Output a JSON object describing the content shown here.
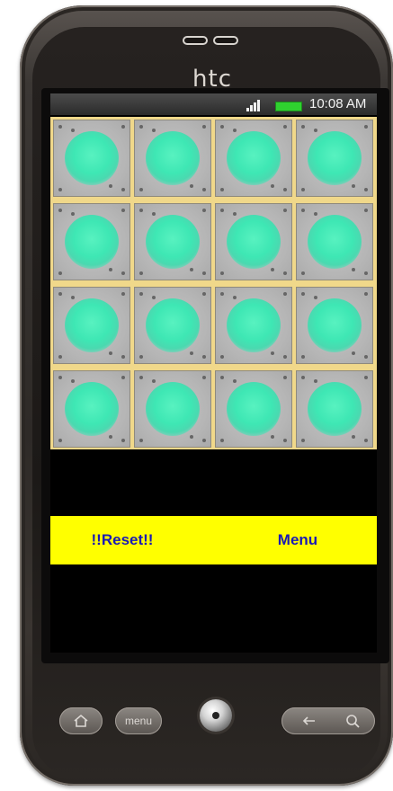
{
  "device": {
    "brand": "htc"
  },
  "status_bar": {
    "time": "10:08 AM",
    "signal_icon": "signal-bars-icon",
    "battery_icon": "battery-icon",
    "battery_color": "#2fd12f"
  },
  "board": {
    "rows": 4,
    "cols": 4,
    "cell_icon": "glowing-light-tile",
    "glow_color": "#3ee7b4",
    "grid_line_color": "#f0d88a"
  },
  "actions": {
    "reset_label": "!!Reset!!",
    "menu_label": "Menu",
    "bar_color": "#ffff00",
    "text_color": "#1a1ab4"
  },
  "hardware_keys": {
    "home_icon": "home-icon",
    "menu_label": "menu",
    "back_icon": "back-arrow-icon",
    "search_icon": "search-icon",
    "trackball": "trackball"
  }
}
